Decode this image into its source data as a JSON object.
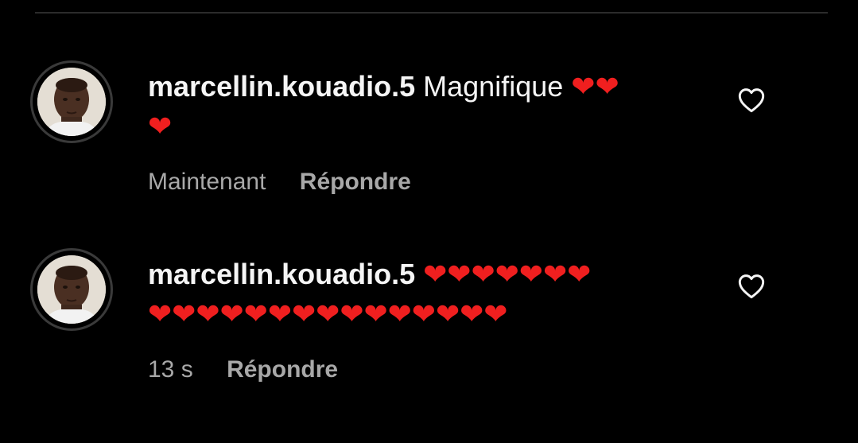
{
  "comments": [
    {
      "username": "marcellin.kouadio.5",
      "text": "Magnifique",
      "hearts_line1": "❤❤",
      "hearts_line2": "❤",
      "time": "Maintenant",
      "reply_label": "Répondre"
    },
    {
      "username": "marcellin.kouadio.5",
      "text": "",
      "hearts_line1": "❤❤❤❤❤❤❤",
      "hearts_line2": "❤❤❤❤❤❤❤❤❤❤❤❤❤❤❤",
      "time": "13 s",
      "reply_label": "Répondre"
    }
  ],
  "colors": {
    "background": "#000000",
    "text": "#f5f5f5",
    "muted": "#a8a8a8",
    "heart": "#f01f1f"
  },
  "icons": {
    "like": "heart-outline-icon",
    "emoji": "red-heart"
  }
}
